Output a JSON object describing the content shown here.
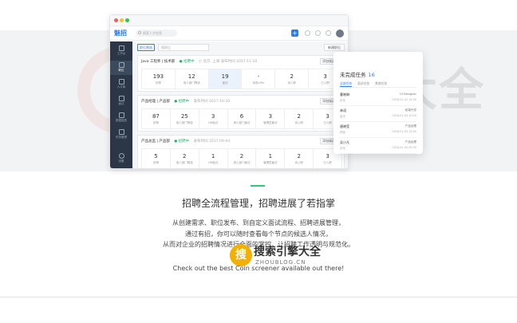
{
  "app": {
    "logo": "魅招",
    "search_placeholder": "搜索人才信息",
    "plus_label": "+",
    "sidebar": [
      {
        "label": "工作台"
      },
      {
        "label": "职位"
      },
      {
        "label": "人才库"
      },
      {
        "label": "面试"
      },
      {
        "label": "数据报表"
      },
      {
        "label": "任务管理"
      },
      {
        "label": "设置"
      }
    ],
    "filter": {
      "button_label": "职位筛选",
      "search_placeholder": "搜职位",
      "new_label": "新建职位"
    },
    "jobs": [
      {
        "title": "Java 工程师 | 技术部",
        "status": "● 招聘中",
        "meta": "◷ 北京, 上海   发布时间 2017-11-10",
        "add_label": "添加候选人",
        "stats": [
          {
            "value": "193",
            "label": "初筛"
          },
          {
            "value": "12",
            "label": "用人部门筛选"
          },
          {
            "value": "19",
            "label": "面试"
          },
          {
            "value": "-",
            "label": "待发offer"
          },
          {
            "value": "2",
            "label": "待入职"
          },
          {
            "value": "3",
            "label": "已入职"
          }
        ]
      },
      {
        "title": "产品经理 | 产品部",
        "status": "● 招聘中",
        "meta": "发布时间 2017-10-20",
        "add_label": "添加候选人",
        "stats": [
          {
            "value": "87",
            "label": "初筛"
          },
          {
            "value": "25",
            "label": "用人部门筛选"
          },
          {
            "value": "3",
            "label": "HR面试"
          },
          {
            "value": "6",
            "label": "用人部门面试"
          },
          {
            "value": "3",
            "label": "管理层面试"
          },
          {
            "value": "2",
            "label": "待入职"
          },
          {
            "value": "3",
            "label": "已入职"
          }
        ]
      },
      {
        "title": "产品总监 | 产品部",
        "status": "● 招聘中",
        "meta": "发布时间 2017-09-04",
        "add_label": "添加候选人",
        "stats": [
          {
            "value": "5",
            "label": "初筛"
          },
          {
            "value": "2",
            "label": "用人部门筛选"
          },
          {
            "value": "1",
            "label": "HR面试"
          },
          {
            "value": "2",
            "label": "用人部门面试"
          },
          {
            "value": "1",
            "label": "管理层面试"
          },
          {
            "value": "2",
            "label": "待入职"
          },
          {
            "value": "3",
            "label": "已入职"
          }
        ]
      }
    ]
  },
  "panel": {
    "title": "未完成任务",
    "count": "16",
    "tabs": [
      "全部任务",
      "面试任务",
      "其他任务"
    ],
    "tasks": [
      {
        "name": "曹晓琳",
        "right": "UI Designer",
        "sub": "初试",
        "sub_right": "2018-01-02 14:30"
      },
      {
        "name": "林语",
        "right": "前端开发",
        "sub": "复试",
        "sub_right": "2018-01-03 10:00"
      },
      {
        "name": "唐晓莹",
        "right": "产品经理",
        "sub": "终面",
        "sub_right": "2018-01-03 15:00"
      },
      {
        "name": "吴小凡",
        "right": "产品经理",
        "sub": "初试",
        "sub_right": "2018-01-04 09:30"
      }
    ]
  },
  "watermark": {
    "text": "搜索引擎大全",
    "url": "ZHOUBLOG.CN",
    "badge_glyph": "搜",
    "badge_text": "搜索引擎大全",
    "badge_url": "ZHOUBLOG.CN"
  },
  "marketing": {
    "headline": "招聘全流程管理，招聘进展了若指掌",
    "lines": [
      "从创建需求、职位发布、到自定义面试流程、招聘进展管理，",
      "通过有招，你可以随时查看每个节点的候选人情况，",
      "从而对企业的招聘情况进行全面的掌控，让招聘工作透明与规范化。"
    ],
    "tagline": "Check out the best Coin screener available out there!"
  },
  "colors": {
    "accent_blue": "#2f7be8",
    "accent_green": "#2ec77b",
    "sidebar_bg": "#2b3746"
  }
}
